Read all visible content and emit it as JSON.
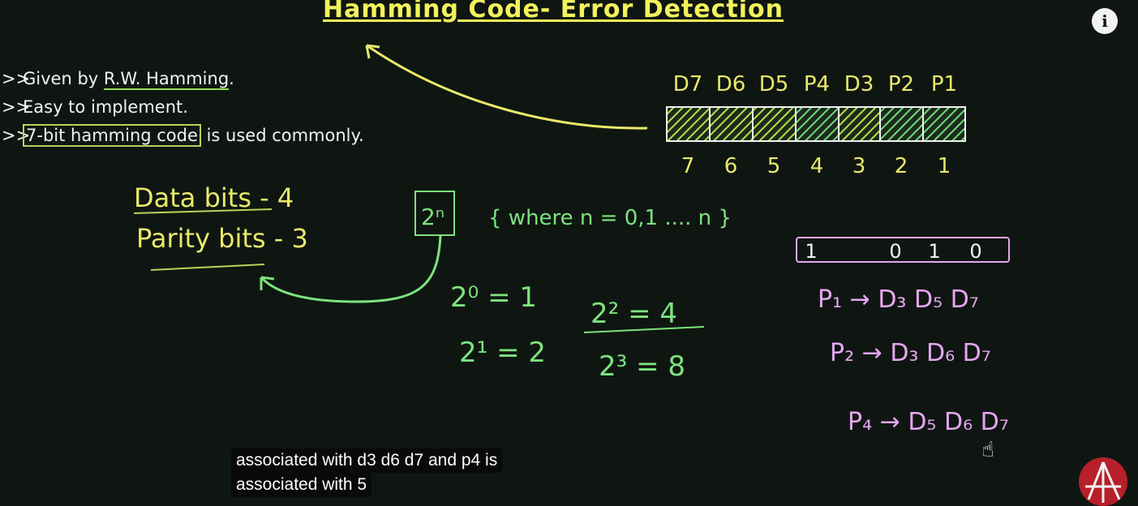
{
  "slide": {
    "title": "Hamming Code- Error Detection",
    "bullets": [
      {
        "marker": ">>",
        "pre": "Given by ",
        "highlight": "R.W. Hamming",
        "post": "."
      },
      {
        "marker": ">>",
        "pre": "Easy to implement.",
        "highlight": "",
        "post": ""
      },
      {
        "marker": ">>",
        "pre": "",
        "highlight": "7-bit hamming code",
        "post": " is used commonly."
      }
    ],
    "bit_labels": [
      "D7",
      "D6",
      "D5",
      "P4",
      "D3",
      "P2",
      "P1"
    ],
    "bit_positions": [
      "7",
      "6",
      "5",
      "4",
      "3",
      "2",
      "1"
    ],
    "notes": {
      "data_bits": "Data bits - 4",
      "parity_bits": "Parity bits - 3",
      "power_formula": "2ⁿ",
      "where_clause": "{ where n = 0,1 .... n }",
      "powers": [
        "2⁰ = 1",
        "2¹ = 2",
        "2² = 4",
        "2³ = 8"
      ],
      "data_word": [
        "1",
        "0",
        "1",
        "0"
      ],
      "parity_rules": [
        "P₁ → D₃ D₅ D₇",
        "P₂ → D₃ D₆ D₇",
        "P₄ → D₅ D₆ D₇"
      ]
    },
    "colors": {
      "background": "#0f1612",
      "title": "#f3f35c",
      "chalk_yellow": "#e9e96a",
      "chalk_green": "#7de37d",
      "chalk_pink": "#e6a6f0"
    }
  },
  "player": {
    "info_icon": "i",
    "caption_lines": [
      "associated with d3 d6 d7 and p4 is",
      "associated with 5"
    ],
    "channel_logo": "channel-logo"
  }
}
